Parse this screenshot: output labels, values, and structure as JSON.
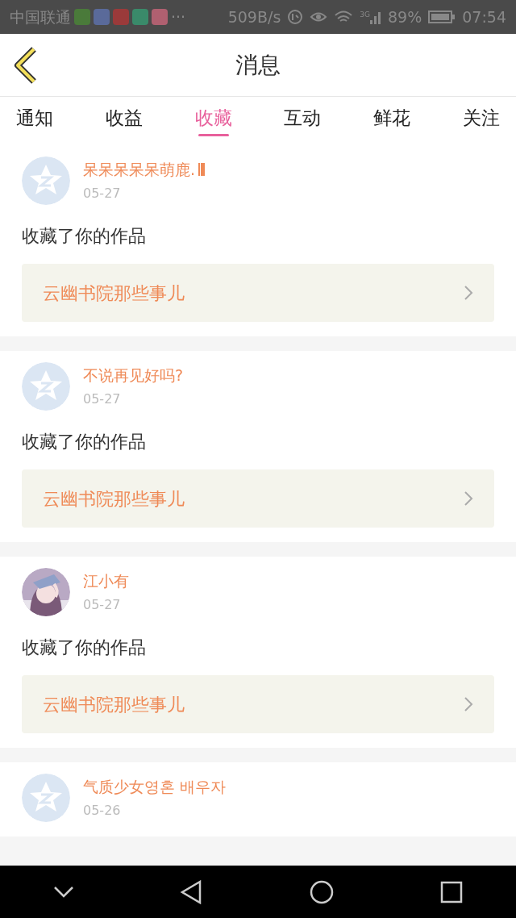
{
  "status_bar": {
    "carrier": "中国联通",
    "more": "···",
    "speed": "509B/s",
    "network": "3G",
    "battery": "89%",
    "time": "07:54"
  },
  "header": {
    "title": "消息"
  },
  "tabs": [
    {
      "label": "通知",
      "selected": false
    },
    {
      "label": "收益",
      "selected": false
    },
    {
      "label": "收藏",
      "selected": true
    },
    {
      "label": "互动",
      "selected": false
    },
    {
      "label": "鲜花",
      "selected": false
    },
    {
      "label": "关注",
      "selected": false
    }
  ],
  "messages": [
    {
      "kind": "default",
      "name": "呆呆呆呆呆萌鹿.",
      "name_badge": true,
      "date": "05-27",
      "action": "收藏了你的作品",
      "work": "云幽书院那些事儿"
    },
    {
      "kind": "default",
      "name": "不说再见好吗?",
      "date": "05-27",
      "action": "收藏了你的作品",
      "work": "云幽书院那些事儿"
    },
    {
      "kind": "picture",
      "name": "江小有",
      "date": "05-27",
      "action": "收藏了你的作品",
      "work": "云幽书院那些事儿"
    },
    {
      "kind": "default",
      "name": "气质少女영혼 배우자",
      "date": "05-26"
    }
  ]
}
